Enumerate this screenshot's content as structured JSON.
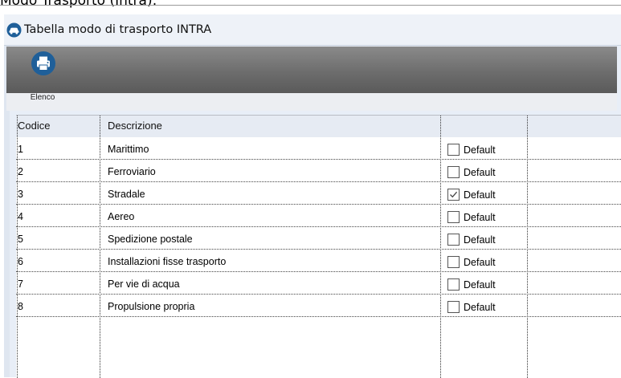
{
  "page_heading": "Modo Trasporto (Intra):",
  "window": {
    "title": "Tabella modo di trasporto INTRA",
    "title_icon": "car-icon"
  },
  "toolbar": {
    "elenco_label": "Elenco",
    "elenco_icon": "printer-icon"
  },
  "columns": {
    "codice": "Codice",
    "descrizione": "Descrizione"
  },
  "default_label": "Default",
  "rows": [
    {
      "code": "1",
      "desc": "Marittimo",
      "default": false
    },
    {
      "code": "2",
      "desc": "Ferroviario",
      "default": false
    },
    {
      "code": "3",
      "desc": "Stradale",
      "default": true
    },
    {
      "code": "4",
      "desc": "Aereo",
      "default": false
    },
    {
      "code": "5",
      "desc": "Spedizione postale",
      "default": false
    },
    {
      "code": "6",
      "desc": "Installazioni fisse trasporto",
      "default": false
    },
    {
      "code": "7",
      "desc": "Per vie di acqua",
      "default": false
    },
    {
      "code": "8",
      "desc": "Propulsione propria",
      "default": false
    }
  ],
  "colors": {
    "accent": "#1f5f99",
    "toolbar": "#6d6d6d",
    "header": "#e6ebf3"
  }
}
